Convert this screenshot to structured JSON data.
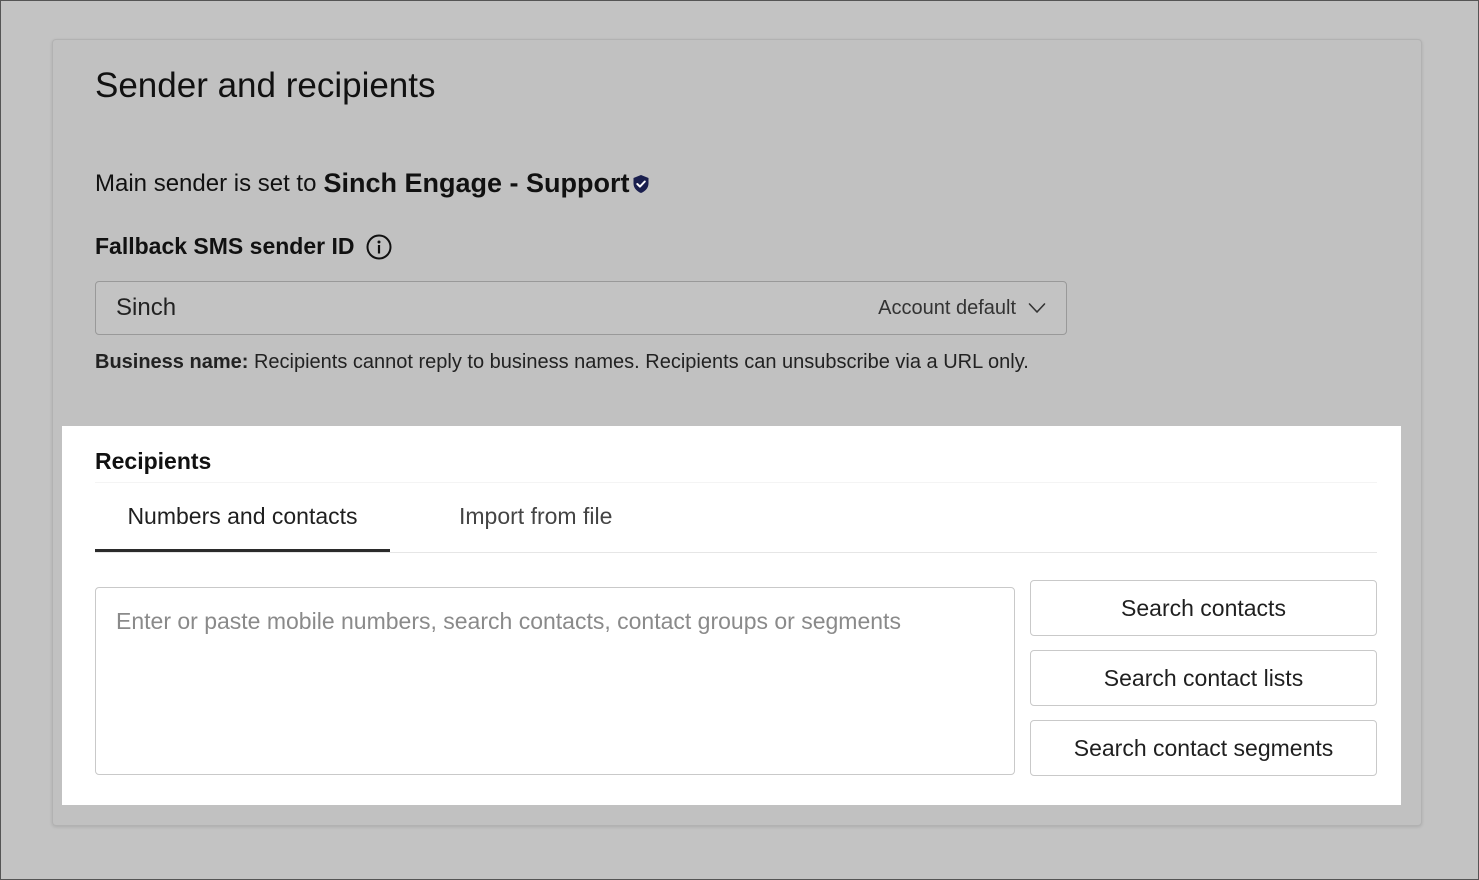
{
  "section": {
    "title": "Sender and recipients"
  },
  "main_sender": {
    "prefix": "Main sender is set to",
    "name": "Sinch Engage - Support"
  },
  "fallback": {
    "label": "Fallback SMS sender ID",
    "selected_value": "Sinch",
    "selected_hint": "Account default",
    "note_bold": "Business name:",
    "note_text": " Recipients cannot reply to business names. Recipients can unsubscribe via a URL only."
  },
  "recipients": {
    "title": "Recipients",
    "tabs": [
      {
        "label": "Numbers and contacts",
        "active": true
      },
      {
        "label": "Import from file",
        "active": false
      }
    ],
    "input_placeholder": "Enter or paste mobile numbers, search contacts, contact groups or segments",
    "buttons": {
      "search_contacts": "Search contacts",
      "search_contact_lists": "Search contact lists",
      "search_contact_segments": "Search contact segments"
    }
  },
  "colors": {
    "overlay_bg": "#c3c3c3",
    "panel_bg": "#ffffff",
    "verified_badge": "#1a1f4e"
  },
  "icons": {
    "verified": "shield-check-icon",
    "info": "info-icon",
    "dropdown": "chevron-down-icon"
  }
}
